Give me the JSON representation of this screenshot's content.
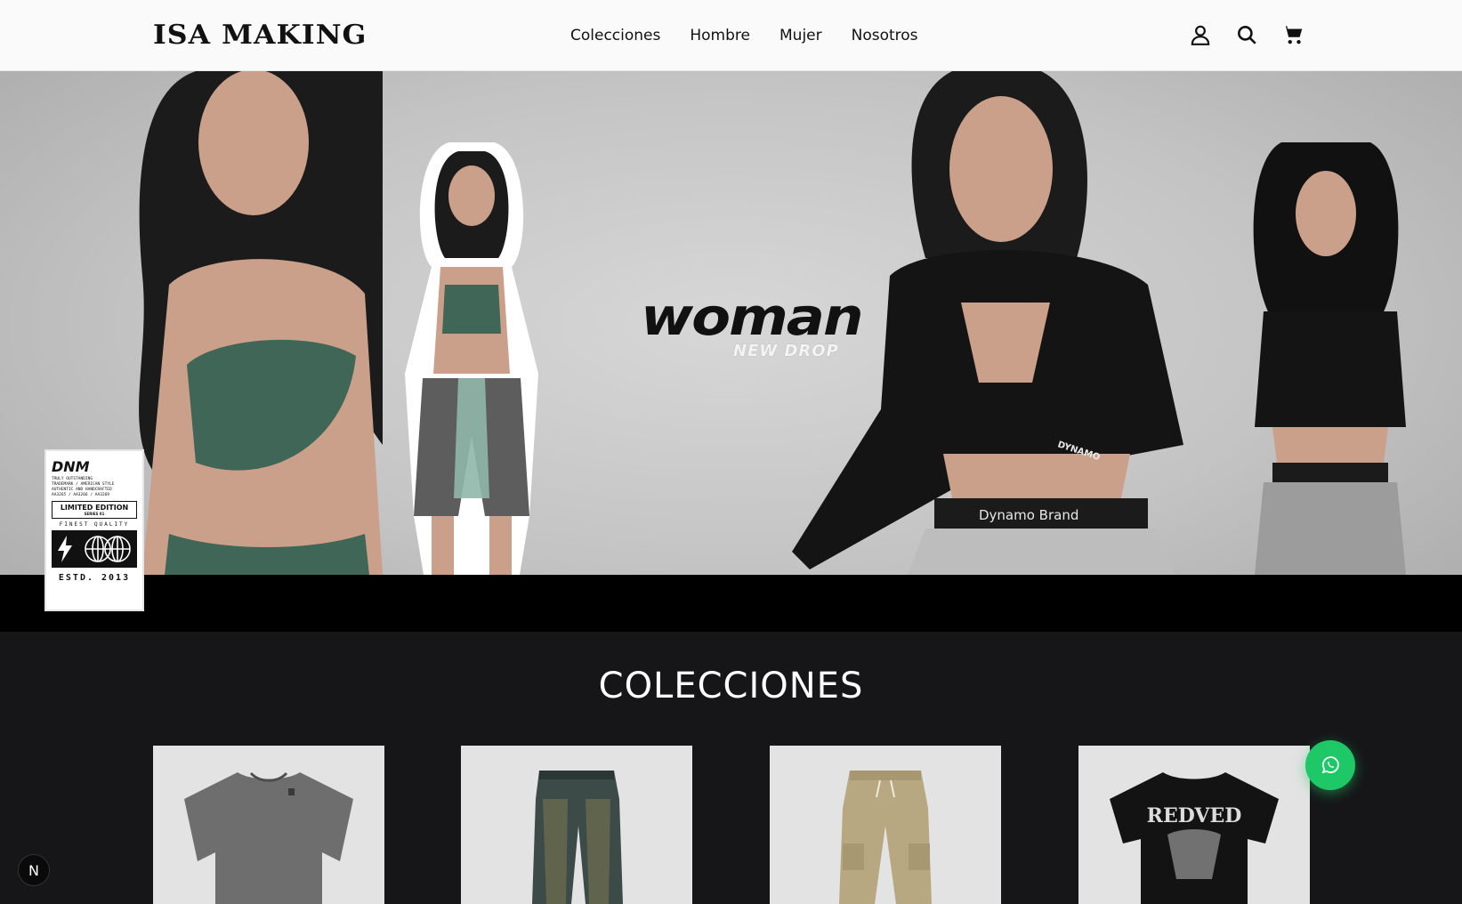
{
  "brand": {
    "logo": "ISA MAKING"
  },
  "nav": {
    "items": [
      {
        "label": "Colecciones"
      },
      {
        "label": "Hombre"
      },
      {
        "label": "Mujer"
      },
      {
        "label": "Nosotros"
      }
    ]
  },
  "header_icons": [
    "user-icon",
    "search-icon",
    "cart-icon"
  ],
  "hero": {
    "title": "woman",
    "subtitle": "NEW DROP",
    "printed_text": [
      "DYNAMO",
      "Dynamo Brand"
    ],
    "badge": {
      "title": "DNM",
      "lines": [
        "TRULY OUTSTANDING",
        "TRADEMARK / AMERICAN STYLE",
        "AUTHENTIC AND HANDCRAFTED",
        "AA3265 / AA3266 / AA3269"
      ],
      "limited": "LIMITED EDITION",
      "series": "SERIES 01",
      "quality": "FINEST QUALITY",
      "estd": "ESTD. 2013"
    }
  },
  "collections": {
    "title": "COLECCIONES",
    "cards": [
      {
        "name": "grey oversized t-shirt"
      },
      {
        "name": "washed baggy jeans"
      },
      {
        "name": "khaki cargo pants"
      },
      {
        "name": "black graphic t-shirt",
        "print_text": "REDVED"
      }
    ]
  },
  "floating": {
    "whatsapp_icon": "whatsapp-icon",
    "dev_badge": "N"
  },
  "colors": {
    "header_bg": "#fafafa",
    "page_bg": "#161618",
    "whatsapp": "#1fc866",
    "text_dark": "#111111"
  }
}
